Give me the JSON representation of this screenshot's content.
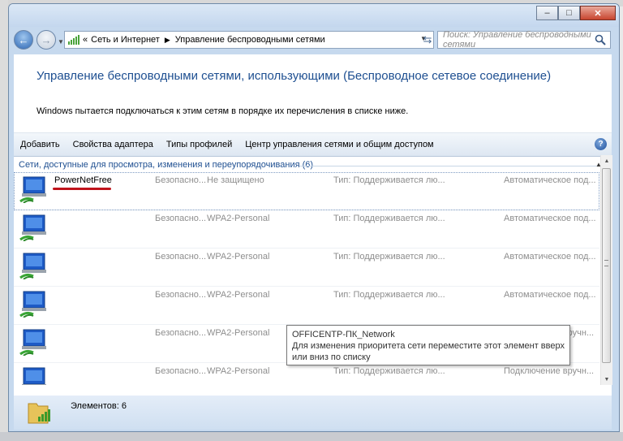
{
  "window": {
    "minimize": "–",
    "maximize": "□",
    "close": "✕"
  },
  "nav": {
    "back": "←",
    "forward": "→",
    "crumb_prefix": "«",
    "crumb1": "Сеть и Интернет",
    "crumb_sep": "▶",
    "crumb2": "Управление беспроводными сетями",
    "search_placeholder": "Поиск: Управление беспроводными сетями"
  },
  "header": {
    "title": "Управление беспроводными сетями, использующими (Беспроводное сетевое соединение)",
    "description": "Windows пытается подключаться к этим сетям в порядке их перечисления в списке ниже."
  },
  "toolbar": {
    "add": "Добавить",
    "adapter": "Свойства адаптера",
    "profiles": "Типы профилей",
    "center": "Центр управления сетями и общим доступом",
    "help": "?"
  },
  "group": {
    "label": "Сети, доступные для просмотра, изменения и переупорядочивания (6)"
  },
  "networks": [
    {
      "name": "PowerNetFree",
      "sec_label": "Безопасно...",
      "security": "Не защищено",
      "type": "Тип:  Поддерживается лю...",
      "mode": "Автоматическое под..."
    },
    {
      "name": "",
      "sec_label": "Безопасно...",
      "security": "WPA2-Personal",
      "type": "Тип:  Поддерживается лю...",
      "mode": "Автоматическое под..."
    },
    {
      "name": "",
      "sec_label": "Безопасно...",
      "security": "WPA2-Personal",
      "type": "Тип:  Поддерживается лю...",
      "mode": "Автоматическое под..."
    },
    {
      "name": "",
      "sec_label": "Безопасно...",
      "security": "WPA2-Personal",
      "type": "Тип:  Поддерживается лю...",
      "mode": "Автоматическое под..."
    },
    {
      "name": "",
      "sec_label": "Безопасно...",
      "security": "WPA2-Personal",
      "type": "Тип:  Поддерживается лю...",
      "mode": "Подключение вручн..."
    },
    {
      "name": "",
      "sec_label": "Безопасно...",
      "security": "WPA2-Personal",
      "type": "Тип:  Поддерживается лю...",
      "mode": "Подключение вручн..."
    }
  ],
  "tooltip": {
    "title": "OFFICENTP-ПК_Network",
    "text": "Для изменения приоритета сети переместите этот элемент вверх или вниз по списку"
  },
  "status": {
    "count": "Элементов: 6"
  }
}
